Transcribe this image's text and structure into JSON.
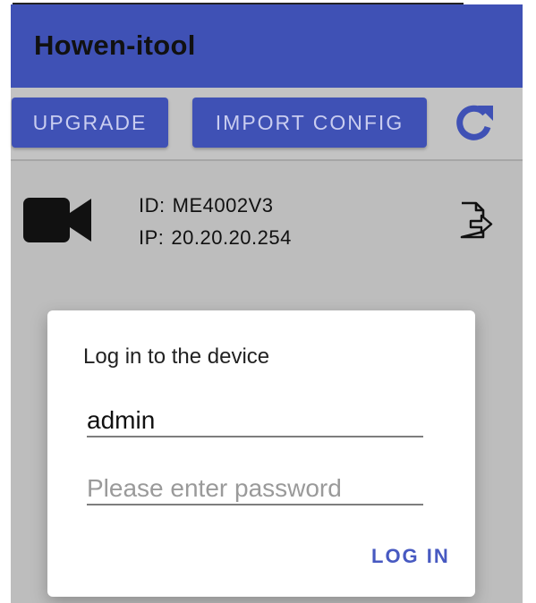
{
  "app": {
    "title": "Howen-itool"
  },
  "toolbar": {
    "upgrade_label": "UPGRADE",
    "import_label": "IMPORT CONFIG",
    "refresh_icon": "refresh-icon"
  },
  "device": {
    "icon": "video-camera-icon",
    "id_label": "ID:",
    "id_value": "ME4002V3",
    "ip_label": "IP:",
    "ip_value": "20.20.20.254",
    "export_icon": "export-file-icon"
  },
  "login_dialog": {
    "title": "Log in to the device",
    "username_value": "admin",
    "password_placeholder": "Please enter password",
    "login_label": "LOG IN"
  },
  "colors": {
    "app_bar": "#3f51b5",
    "background": "#bdbdbd",
    "accent_text": "#4759c1"
  }
}
